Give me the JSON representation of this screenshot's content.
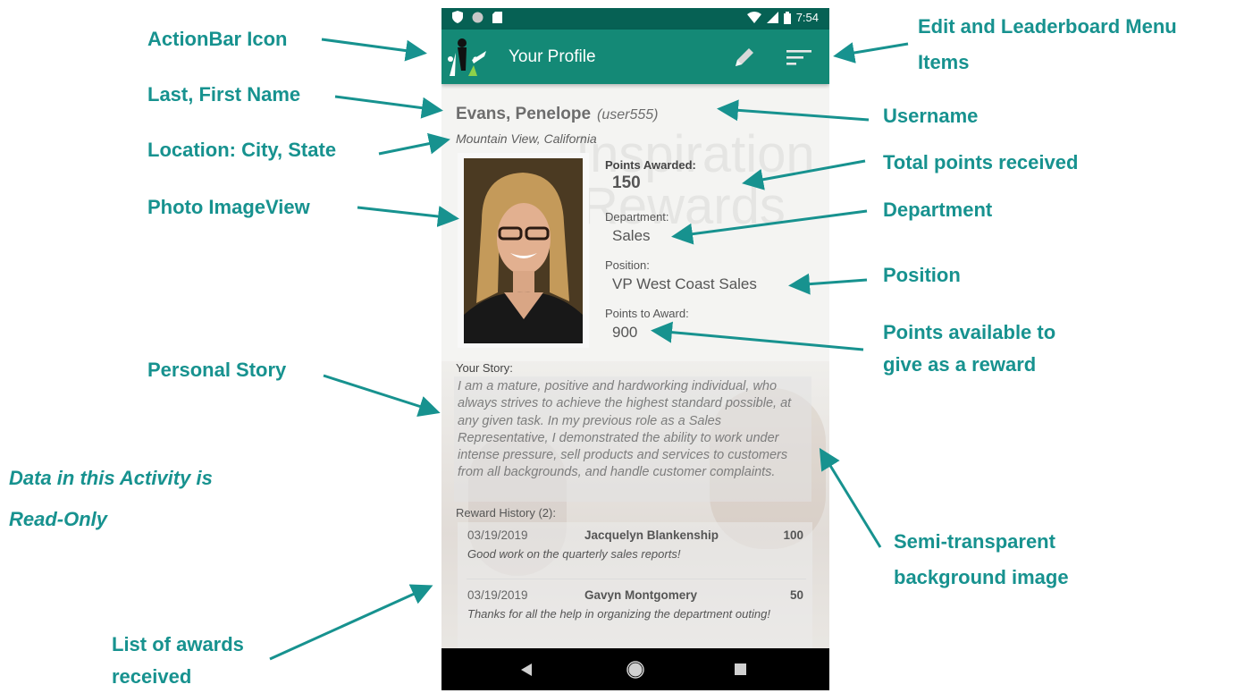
{
  "annotations": {
    "actionbar_icon": "ActionBar Icon",
    "last_first_name": "Last, First Name",
    "location": "Location: City, State",
    "photo_imageview": "Photo ImageView",
    "personal_story": "Personal Story",
    "read_only_line1": "Data in this Activity is",
    "read_only_line2": "Read-Only",
    "list_awards_line1": "List of awards",
    "list_awards_line2": "received",
    "edit_leaderboard_line1": "Edit and Leaderboard Menu",
    "edit_leaderboard_line2": "Items",
    "username": "Username",
    "total_points": "Total points received",
    "department": "Department",
    "position": "Position",
    "points_available_line1": "Points available to",
    "points_available_line2": "give as a reward",
    "background_line1": "Semi-transparent",
    "background_line2": "background image"
  },
  "colors": {
    "annotation": "#17928f",
    "statusbar": "#066154",
    "actionbar": "#148976"
  },
  "statusbar": {
    "time": "7:54",
    "icons": [
      "shield-icon",
      "circle-icon",
      "sd-card-icon",
      "wifi-icon",
      "signal-icon",
      "battery-icon"
    ]
  },
  "actionbar": {
    "title": "Your Profile",
    "icons": [
      "app-logo-icon",
      "edit-pencil-icon",
      "leaderboard-sort-icon"
    ]
  },
  "profile": {
    "name": "Evans, Penelope",
    "username": "(user555)",
    "location": "Mountain View, California",
    "points_awarded_label": "Points Awarded:",
    "points_awarded": "150",
    "department_label": "Department:",
    "department": "Sales",
    "position_label": "Position:",
    "position": "VP West Coast Sales",
    "points_to_award_label": "Points to Award:",
    "points_to_award": "900",
    "story_label": "Your Story:",
    "story": "I am a mature, positive and hardworking individual, who always strives to achieve the highest standard possible, at any given task. In my previous role as a Sales Representative, I demonstrated the ability to work under intense pressure, sell products and services to customers from all backgrounds, and handle customer complaints.",
    "reward_history_label": "Reward History (2):",
    "rewards": [
      {
        "date": "03/19/2019",
        "from": "Jacquelyn Blankenship",
        "points": "100",
        "note": "Good work on the quarterly sales reports!"
      },
      {
        "date": "03/19/2019",
        "from": "Gavyn Montgomery",
        "points": "50",
        "note": "Thanks for all the help in organizing the department outing!"
      }
    ]
  },
  "background_watermark": {
    "line1": "Inspiration",
    "line2": "Rewards"
  },
  "navbar": {
    "icons": [
      "back-icon",
      "home-icon",
      "recents-icon"
    ]
  }
}
